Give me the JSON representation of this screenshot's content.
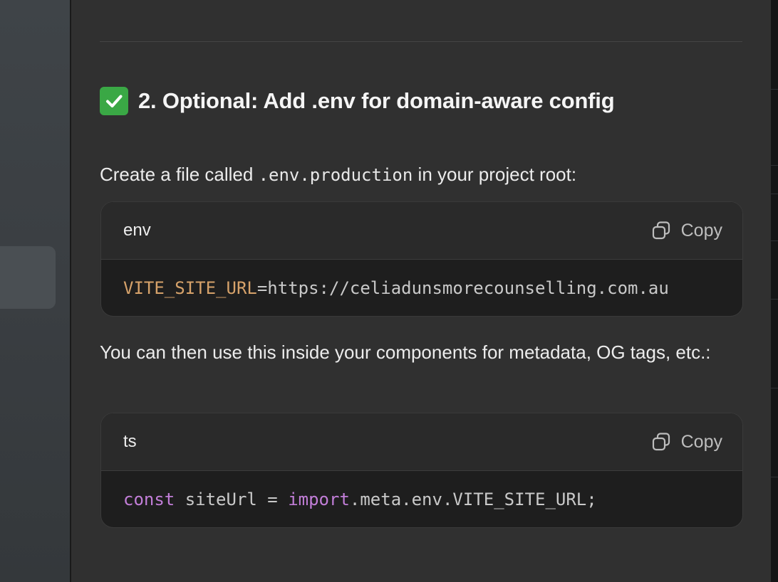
{
  "heading": {
    "text": "2. Optional: Add .env for domain-aware config",
    "icon": "check-mark-button-icon"
  },
  "intro": {
    "before": "Create a file called ",
    "code": ".env.production",
    "after": " in your project root:"
  },
  "code_block_env": {
    "language": "env",
    "copy_label": "Copy",
    "line": {
      "key": "VITE_SITE_URL",
      "equals": "=",
      "value": "https://celiadunsmorecounselling.com.au"
    }
  },
  "usage_text": "You can then use this inside your components for metadata, OG tags, etc.:",
  "code_block_ts": {
    "language": "ts",
    "copy_label": "Copy",
    "line": {
      "kw1": "const",
      "mid": " siteUrl = ",
      "kw2": "import",
      "rest": ".meta.env.VITE_SITE_URL;"
    }
  },
  "colors": {
    "background": "#303030",
    "code_bg": "#1e1e1e",
    "env_key": "#d6a26a",
    "keyword": "#c27ed8",
    "check_green": "#3aa845"
  }
}
